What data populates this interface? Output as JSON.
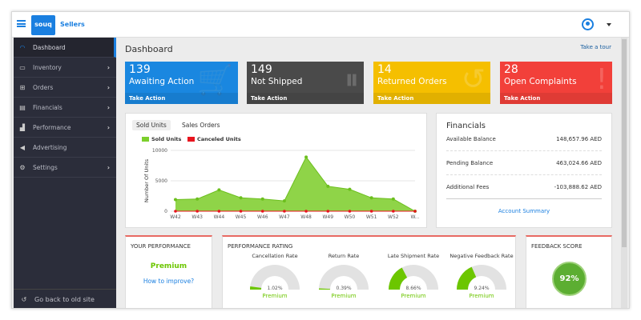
{
  "header": {
    "logo": "souq",
    "brand": "Sellers"
  },
  "sidebar": {
    "items": [
      {
        "label": "Dashboard",
        "icon": "gauge-icon",
        "active": true,
        "chevron": false
      },
      {
        "label": "Inventory",
        "icon": "boxes-icon",
        "chevron": true
      },
      {
        "label": "Orders",
        "icon": "cart-icon",
        "chevron": true
      },
      {
        "label": "Financials",
        "icon": "money-icon",
        "chevron": true
      },
      {
        "label": "Performance",
        "icon": "bars-icon",
        "chevron": true
      },
      {
        "label": "Advertising",
        "icon": "megaphone-icon",
        "chevron": false
      },
      {
        "label": "Settings",
        "icon": "gear-icon",
        "chevron": true
      }
    ],
    "old_site": "Go back to old site"
  },
  "page": {
    "title": "Dashboard",
    "tour": "Take a tour"
  },
  "cards": [
    {
      "num": "139",
      "label": "Awaiting Action",
      "action": "Take Action",
      "color": "#1a87e0",
      "icon": "cart-icon"
    },
    {
      "num": "149",
      "label": "Not Shipped",
      "action": "Take Action",
      "color": "#4a4a4a",
      "icon": "truck-icon"
    },
    {
      "num": "14",
      "label": "Returned Orders",
      "action": "Take Action",
      "color": "#f5bf00",
      "icon": "return-icon"
    },
    {
      "num": "28",
      "label": "Open Complaints",
      "action": "Take Action",
      "color": "#f2403a",
      "icon": "alert-icon"
    }
  ],
  "chart_tabs": [
    "Sold Units",
    "Sales Orders"
  ],
  "chart_data": {
    "type": "area",
    "x": [
      "W42",
      "W43",
      "W44",
      "W45",
      "W46",
      "W47",
      "W48",
      "W49",
      "W50",
      "W51",
      "W52",
      "W..."
    ],
    "series": [
      {
        "name": "Sold Units",
        "color": "#7ccf2c",
        "values": [
          1900,
          2000,
          3500,
          2200,
          2000,
          1700,
          8900,
          4100,
          3600,
          2200,
          2000,
          0
        ]
      },
      {
        "name": "Canceled Units",
        "color": "#e8141e",
        "values": [
          0,
          0,
          0,
          0,
          0,
          0,
          0,
          0,
          0,
          0,
          0,
          0
        ]
      }
    ],
    "ylabel": "Number Of Units",
    "ylim": [
      0,
      10000
    ],
    "yticks": [
      "0",
      "5000",
      "10000"
    ],
    "legend": "top-left",
    "grid": true
  },
  "financials": {
    "title": "Financials",
    "rows": [
      {
        "label": "Available Balance",
        "value": "148,657.96 AED"
      },
      {
        "label": "Pending Balance",
        "value": "463,024.66 AED"
      },
      {
        "label": "Additional Fees",
        "value": "-103,888.62 AED"
      }
    ],
    "link": "Account Summary"
  },
  "your_performance": {
    "title": "YOUR PERFORMANCE",
    "status": "Premium",
    "link": "How to improve?"
  },
  "rating": {
    "title": "PERFORMANCE RATING",
    "gauges": [
      {
        "title": "Cancellation Rate",
        "value": "1.02%",
        "pct": 1.02,
        "status": "Premium"
      },
      {
        "title": "Return Rate",
        "value": "0.39%",
        "pct": 0.39,
        "status": "Premium"
      },
      {
        "title": "Late Shipment Rate",
        "value": "8.66%",
        "pct": 8.66,
        "status": "Premium"
      },
      {
        "title": "Negative Feedback Rate",
        "value": "9.24%",
        "pct": 9.24,
        "status": "Premium"
      }
    ]
  },
  "feedback": {
    "title": "FEEDBACK SCORE",
    "value": "92%"
  }
}
